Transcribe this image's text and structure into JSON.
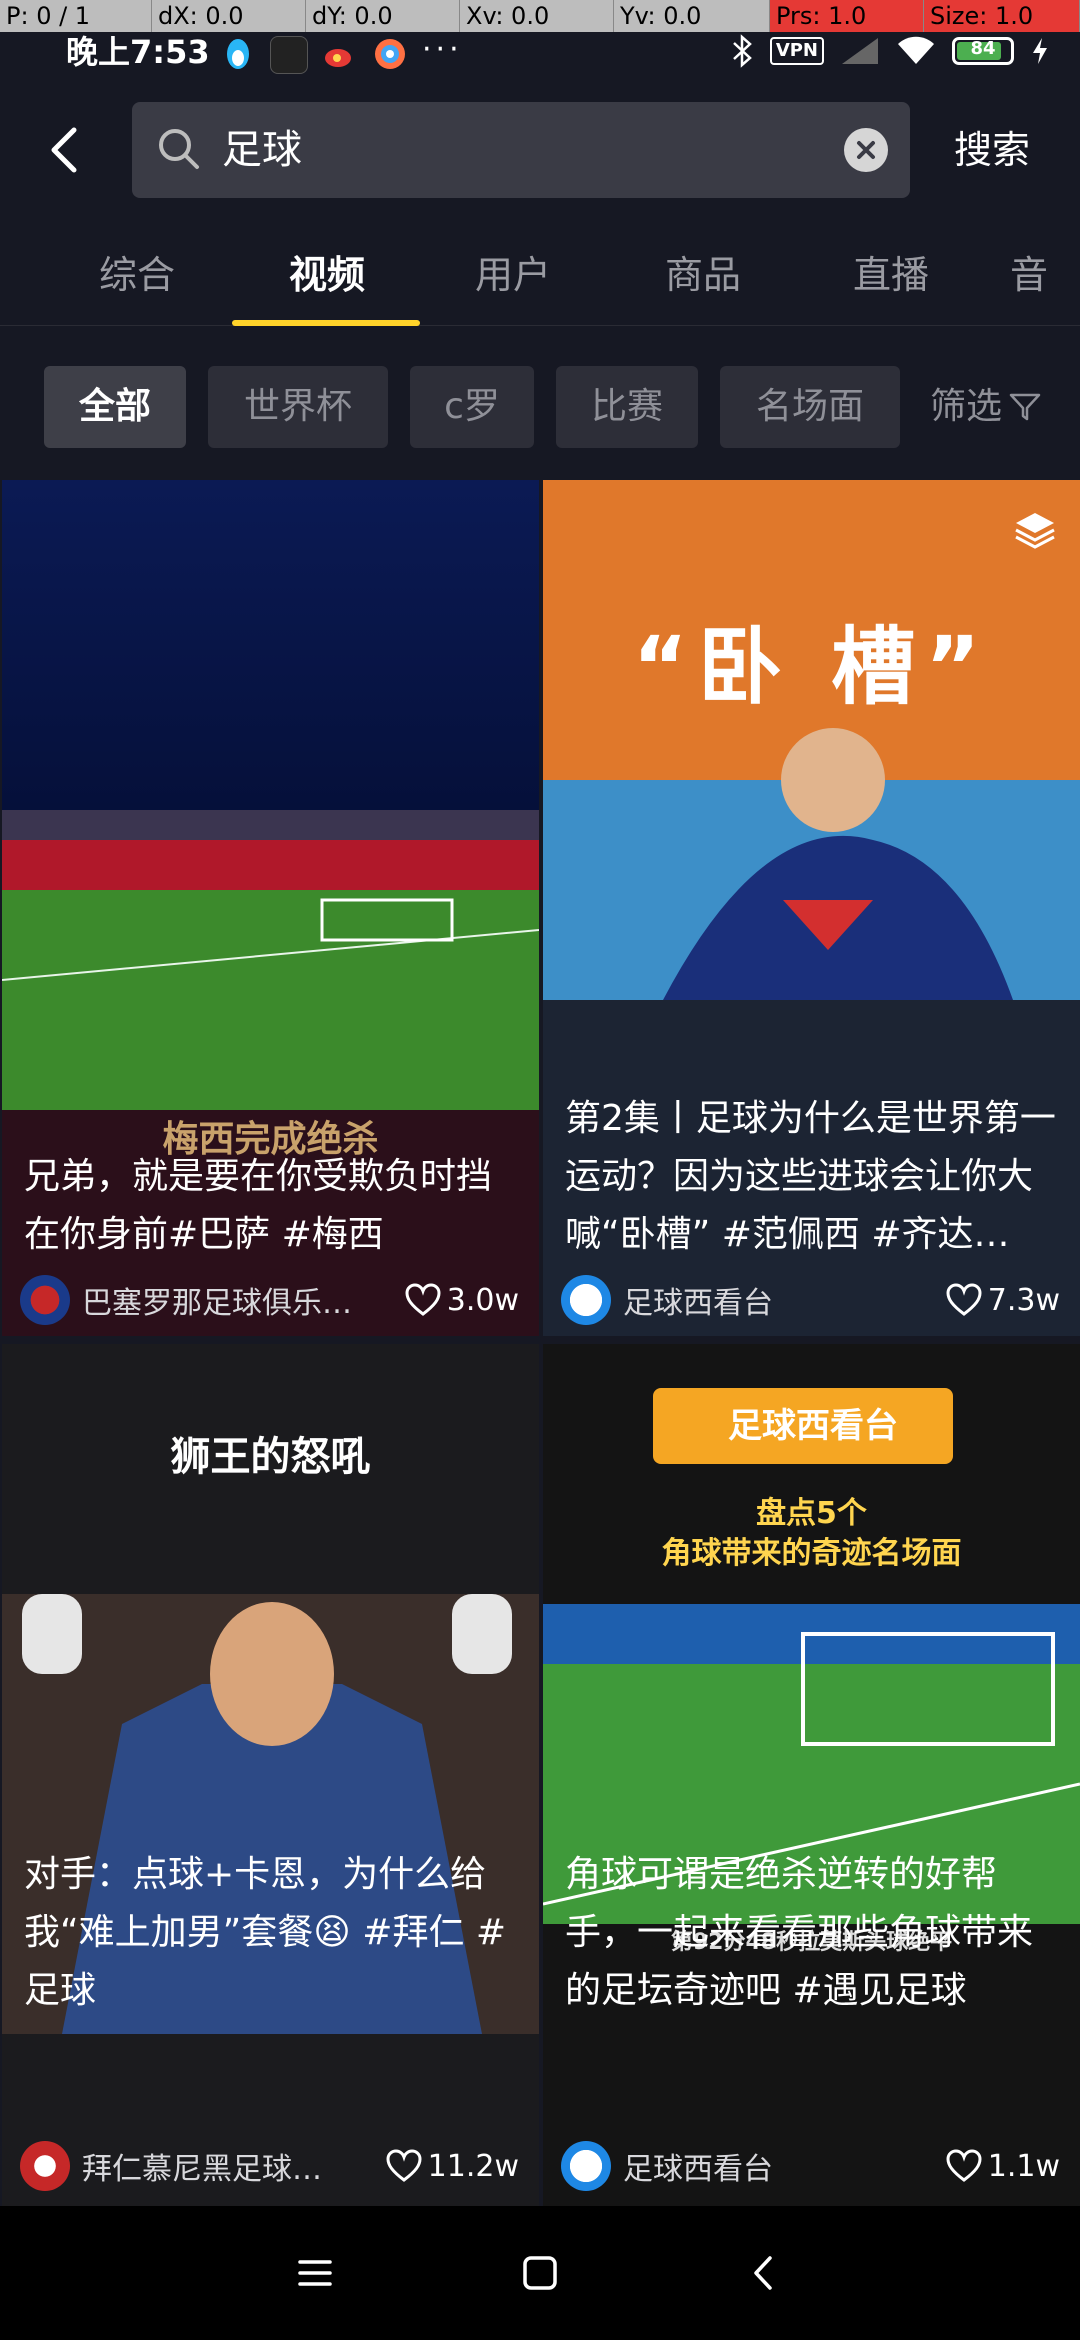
{
  "debug": {
    "pointer": "P: 0 / 1",
    "dx": "dX: 0.0",
    "dy": "dY: 0.0",
    "xv": "Xv: 0.0",
    "yv": "Yv: 0.0",
    "prs": "Prs: 1.0",
    "size": "Size: 1.0"
  },
  "status": {
    "time": "晚上7:53",
    "dots": "···",
    "vpn": "VPN",
    "battery": "84",
    "battery_level": 0.84,
    "icons": [
      "penguin-icon",
      "app-icon",
      "weibo-icon",
      "browser-icon",
      "bluetooth-icon",
      "vpn-icon",
      "signal-icon",
      "wifi-icon",
      "battery-icon",
      "charging-icon"
    ]
  },
  "search": {
    "query": "足球",
    "button": "搜索"
  },
  "tabs": [
    "综合",
    "视频",
    "用户",
    "商品",
    "直播",
    "音"
  ],
  "active_tab": "视频",
  "chips": [
    "全部",
    "世界杯",
    "c罗",
    "比赛",
    "名场面"
  ],
  "filter": "筛选",
  "cards": [
    {
      "title": "兄弟，就是要在你受欺负时挡在你身前#巴萨 #梅西",
      "caption": "梅西完成绝杀",
      "author": "巴塞罗那足球俱乐…",
      "likes": "3.0w"
    },
    {
      "title": "第2集丨足球为什么是世界第一运动？因为这些进球会让你大喊“卧槽” #范佩西 #齐达…",
      "caption": "“卧 槽”",
      "author": "足球西看台",
      "likes": "7.3w"
    },
    {
      "title": "对手：点球+卡恩，为什么给我“难上加男”套餐😫 #拜仁 #足球",
      "caption": "狮王的怒吼",
      "author": "拜仁慕尼黑足球…",
      "likes": "11.2w"
    },
    {
      "title": "角球可谓是绝杀逆转的好帮手，一起来看看那些角球带来的足坛奇迹吧 #遇见足球",
      "banner": "足球西看台",
      "caption": "盘点5个\n角球带来的奇迹名场面",
      "footer": "第92分48秒拉莫斯头球绝平",
      "author": "足球西看台",
      "likes": "1.1w"
    }
  ],
  "colors": {
    "background": "#161823",
    "accent": "#ffd32a",
    "card": "#1f2029"
  }
}
